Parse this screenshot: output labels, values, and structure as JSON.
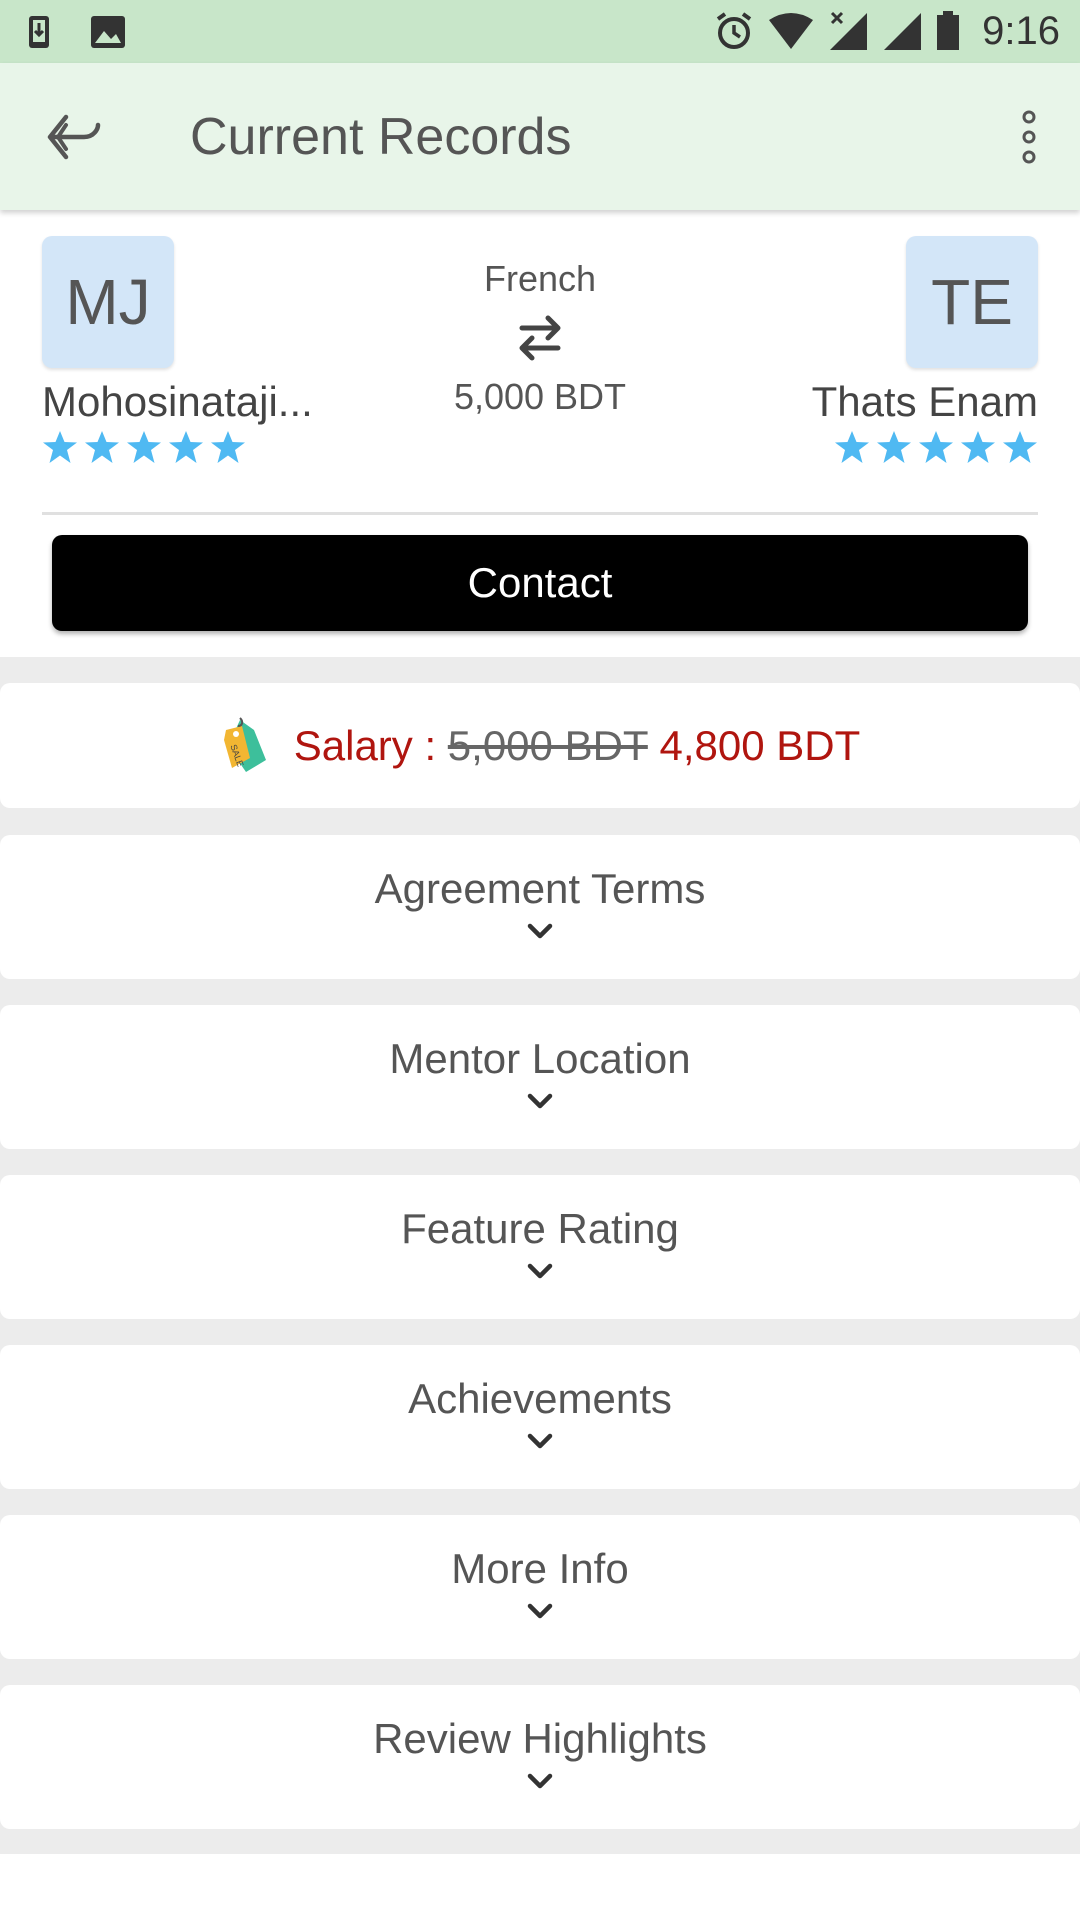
{
  "status_bar": {
    "time": "9:16",
    "icons": [
      "download-icon",
      "image-icon",
      "alarm-icon",
      "wifi-icon",
      "signal-off-icon",
      "signal-icon",
      "battery-icon"
    ]
  },
  "app_bar": {
    "title": "Current Records",
    "icons": [
      "back-arrow-icon",
      "more-vert-icon"
    ]
  },
  "match": {
    "left_profile": {
      "initials": "MJ",
      "name": "Mohosinataji...",
      "stars": 5
    },
    "right_profile": {
      "initials": "TE",
      "name": "Thats Enam",
      "stars": 5
    },
    "subject": "French",
    "fee": "5,000 BDT",
    "contact_label": "Contact"
  },
  "salary": {
    "label": "Salary :",
    "old_value": "5,000 BDT",
    "new_value": "4,800 BDT"
  },
  "sections": [
    {
      "title": "Agreement Terms"
    },
    {
      "title": "Mentor Location"
    },
    {
      "title": "Feature Rating"
    },
    {
      "title": "Achievements"
    },
    {
      "title": "More Info"
    },
    {
      "title": "Review Highlights"
    }
  ],
  "colors": {
    "status_bar": "#c8e6c9",
    "app_bar": "#e8f5e9",
    "avatar_bg": "#d3e6f8",
    "star": "#4fb9f2",
    "salary_red": "#b0150f",
    "contact_button": "#000000"
  }
}
